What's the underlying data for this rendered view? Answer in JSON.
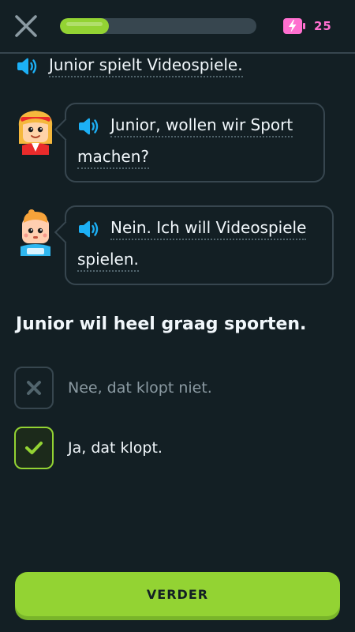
{
  "header": {
    "progress": 0.25,
    "energy_count": "25"
  },
  "dialogue": {
    "narration": "Junior spielt Videospiele.",
    "bubble1": {
      "line1": "Junior, wollen wir Sport",
      "line2": "machen?"
    },
    "bubble2": {
      "line1": "Nein. Ich will Videospiele",
      "line2": "spielen."
    }
  },
  "question": "Junior wil heel graag sporten.",
  "options": [
    {
      "label": "Nee, dat klopt niet.",
      "selected": false,
      "icon": "x-icon"
    },
    {
      "label": "Ja, dat klopt.",
      "selected": true,
      "icon": "check-icon"
    }
  ],
  "continue_label": "VERDER",
  "colors": {
    "background": "#131f24",
    "accent_green": "#93d333",
    "energy_pink": "#ff6fcf",
    "speaker_blue": "#1cb0f6",
    "border": "#37464f"
  }
}
